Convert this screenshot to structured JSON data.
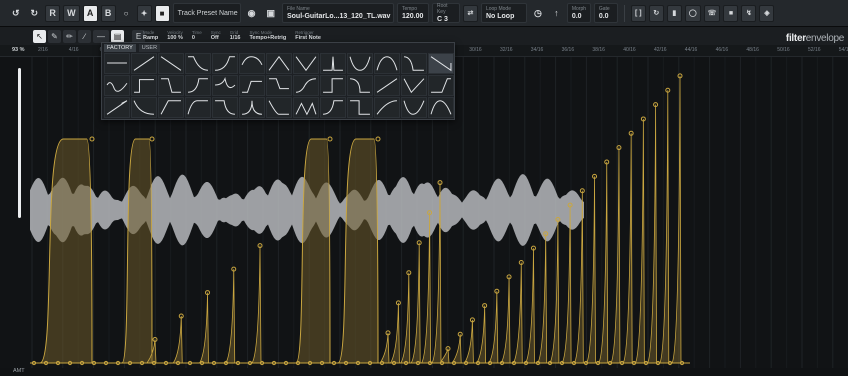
{
  "toolbar": {
    "undo_icon": "undo-icon",
    "redo_icon": "redo-icon",
    "read_label": "R",
    "write_label": "W",
    "a_label": "A",
    "b_label": "B",
    "track_preset": {
      "label": "",
      "value": "Track Preset Name"
    },
    "file_name": {
      "label": "File Name",
      "value": "Soul-GuitarLo...13_120_TL.wav"
    },
    "tempo": {
      "label": "Tempo",
      "value": "120.00"
    },
    "root_key": {
      "label": "Root Key",
      "value": "C 3"
    },
    "loop_mode": {
      "label": "Loop Mode",
      "value": "No Loop"
    },
    "morph": {
      "label": "Morph",
      "value": "0.0"
    },
    "gate": {
      "label": "Gate",
      "value": "0.0"
    }
  },
  "modes": [
    {
      "label": "Mode",
      "value": "Ramp"
    },
    {
      "label": "Velocity",
      "value": "100 %"
    },
    {
      "label": "Time",
      "value": "0"
    },
    {
      "label": "Sync",
      "value": "Off"
    },
    {
      "label": "Grid",
      "value": "1/16"
    },
    {
      "label": "Sync Mode",
      "value": "Tempo+Retrig"
    },
    {
      "label": "Retrigger",
      "value": "First Note"
    }
  ],
  "brand": {
    "bold": "filter",
    "light": "envelope"
  },
  "amount": {
    "percent_label": "93 %",
    "amt_label": "AMT",
    "level": 0.93
  },
  "ruler": [
    "2/16",
    "4/16",
    "6/16",
    "8/16",
    "10/16",
    "12/16",
    "14/16",
    "16/16",
    "18/16",
    "20/16",
    "22/16",
    "24/16",
    "26/16",
    "28/16",
    "30/16",
    "32/16",
    "34/16",
    "36/16",
    "38/16",
    "40/16",
    "42/16",
    "44/16",
    "46/16",
    "48/16",
    "50/16",
    "52/16",
    "54/16"
  ],
  "popup": {
    "tabs": [
      "FACTORY",
      "USER"
    ],
    "selected_index": 12
  },
  "colors": {
    "envelope_fill": "#6b5a2a",
    "envelope_line": "#c9a640",
    "waveform": "#b6b9bc",
    "background": "#111315",
    "toolbar": "#24282c"
  }
}
